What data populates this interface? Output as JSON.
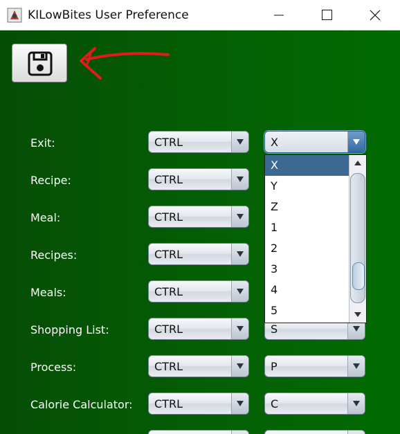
{
  "window": {
    "title": "KILowBites User Preference",
    "icon": "java-app-icon"
  },
  "toolbar": {
    "save_icon": "floppy-disk-icon"
  },
  "rows": [
    {
      "label": "Exit:",
      "modifier": "CTRL",
      "key": "X"
    },
    {
      "label": "Recipe:",
      "modifier": "CTRL",
      "key": ""
    },
    {
      "label": "Meal:",
      "modifier": "CTRL",
      "key": ""
    },
    {
      "label": "Recipes:",
      "modifier": "CTRL",
      "key": ""
    },
    {
      "label": "Meals:",
      "modifier": "CTRL",
      "key": ""
    },
    {
      "label": "Shopping List:",
      "modifier": "CTRL",
      "key": "S"
    },
    {
      "label": "Process:",
      "modifier": "CTRL",
      "key": "P"
    },
    {
      "label": "Calorie Calculator:",
      "modifier": "CTRL",
      "key": "C"
    }
  ],
  "dropdown": {
    "options": [
      "X",
      "Y",
      "Z",
      "1",
      "2",
      "3",
      "4",
      "5"
    ],
    "selected": "X"
  },
  "colors": {
    "background": "#045f04",
    "selection": "#3c6991",
    "annotation_arrow": "#e11b1b"
  }
}
